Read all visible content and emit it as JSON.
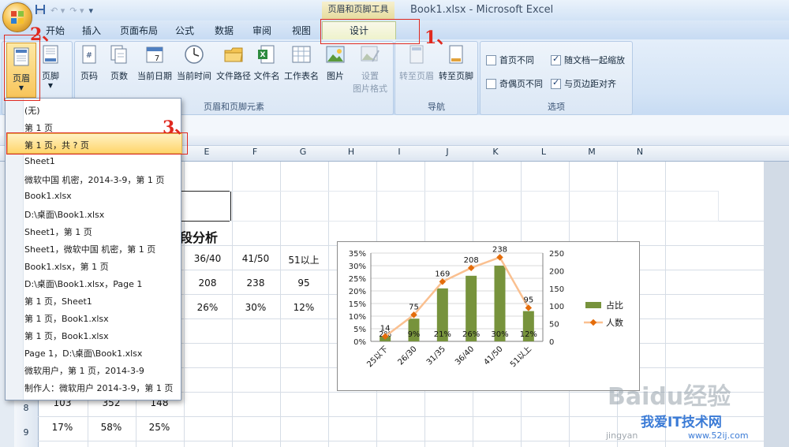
{
  "window": {
    "title": "Book1.xlsx - Microsoft Excel",
    "context_tab_group": "页眉和页脚工具"
  },
  "tabs": [
    {
      "label": "开始"
    },
    {
      "label": "插入"
    },
    {
      "label": "页面布局"
    },
    {
      "label": "公式"
    },
    {
      "label": "数据"
    },
    {
      "label": "审阅"
    },
    {
      "label": "视图"
    },
    {
      "label": "设计"
    }
  ],
  "ribbon": {
    "header_footer": {
      "header_label": "页眉",
      "footer_label": "页脚"
    },
    "elements_group": {
      "label": "页眉和页脚元素",
      "buttons": [
        "页码",
        "页数",
        "当前日期",
        "当前时间",
        "文件路径",
        "文件名",
        "工作表名",
        "图片",
        "设置",
        "图片格式"
      ]
    },
    "nav_group": {
      "label": "导航",
      "goto_header": "转至页眉",
      "goto_footer": "转至页脚"
    },
    "options_group": {
      "label": "选项",
      "options": [
        {
          "label": "首页不同",
          "checked": false
        },
        {
          "label": "随文档一起缩放",
          "checked": true
        },
        {
          "label": "奇偶页不同",
          "checked": false
        },
        {
          "label": "与页边距对齐",
          "checked": true
        }
      ]
    }
  },
  "dropdown": {
    "items": [
      "(无)",
      "第 1 页",
      "第 1 页，共 ? 页",
      "Sheet1",
      "微软中国 机密，2014-3-9，第 1 页",
      "Book1.xlsx",
      "D:\\桌面\\Book1.xlsx",
      "Sheet1，第 1 页",
      "Sheet1，微软中国 机密，第 1 页",
      "Book1.xlsx，第 1 页",
      "D:\\桌面\\Book1.xlsx，Page 1",
      "第 1 页，Sheet1",
      "第 1 页，Book1.xlsx",
      "第 1 页，Book1.xlsx",
      "Page 1，D:\\桌面\\Book1.xlsx",
      "微软用户，第 1 页，2014-3-9",
      "制作人：微软用户 2014-3-9，第 1 页"
    ],
    "highlighted_index": 2
  },
  "columns": [
    "E",
    "F",
    "G",
    "H",
    "I",
    "J",
    "K",
    "L",
    "M",
    "N"
  ],
  "sheet": {
    "title_fragment": "段分析",
    "headers": [
      "36/40",
      "41/50",
      "51以上"
    ],
    "counts": [
      "208",
      "238",
      "95"
    ],
    "ratios": [
      "26%",
      "30%",
      "12%"
    ],
    "rows": [
      {
        "row": "8",
        "cells": [
          "103",
          "352",
          "148"
        ]
      },
      {
        "row": "9",
        "cells": [
          "17%",
          "58%",
          "25%"
        ]
      }
    ]
  },
  "annotations": [
    "1、",
    "2、",
    "3、"
  ],
  "watermark": {
    "brand": "Baidu经验",
    "site_cn": "我爱IT技术网",
    "url": "www.52ij.com",
    "url_left": "jingyan"
  },
  "chart_data": {
    "type": "bar",
    "categories": [
      "25以下",
      "26/30",
      "31/35",
      "36/40",
      "41/50",
      "51以上"
    ],
    "series": [
      {
        "name": "占比",
        "type": "bar",
        "axis": "left",
        "values": [
          2,
          9,
          21,
          26,
          30,
          12
        ],
        "labels": [
          "2%",
          "9%",
          "21%",
          "26%",
          "30%",
          "12%"
        ],
        "color": "#77933c"
      },
      {
        "name": "人数",
        "type": "line",
        "axis": "right",
        "values": [
          14,
          75,
          169,
          208,
          238,
          95
        ],
        "labels": [
          "14",
          "75",
          "169",
          "208",
          "238",
          "95"
        ],
        "color": "#f79646"
      }
    ],
    "y_left": {
      "min": 0,
      "max": 35,
      "step": 5,
      "ticks": [
        "0%",
        "5%",
        "10%",
        "15%",
        "20%",
        "25%",
        "30%",
        "35%"
      ]
    },
    "y_right": {
      "min": 0,
      "max": 250,
      "step": 50,
      "ticks": [
        "0",
        "50",
        "100",
        "150",
        "200",
        "250"
      ]
    },
    "legend": "right"
  }
}
